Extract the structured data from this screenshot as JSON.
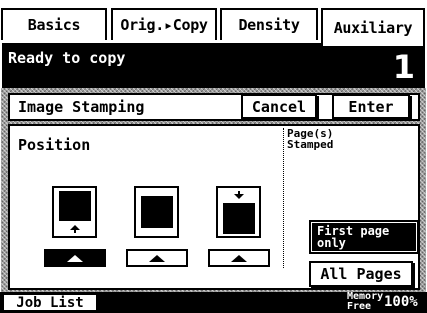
{
  "tabs": [
    {
      "label": "Basics"
    },
    {
      "label": "Orig.▸Copy"
    },
    {
      "label": "Density"
    },
    {
      "label": "Auxiliary"
    }
  ],
  "status": {
    "message": "Ready to copy",
    "copy_count": "1"
  },
  "panel": {
    "title": "Image Stamping",
    "cancel_label": "Cancel",
    "enter_label": "Enter",
    "position_label": "Position",
    "pages_stamped_label": "Page(s)\nStamped",
    "options": [
      {
        "name": "bottom",
        "selected": true
      },
      {
        "name": "center",
        "selected": false
      },
      {
        "name": "top",
        "selected": false
      }
    ],
    "first_page_only_label": "First page\nonly",
    "all_pages_label": "All Pages"
  },
  "footer": {
    "job_list_label": "Job List",
    "memory_label": "Memory\nFree",
    "memory_value": "100%"
  }
}
